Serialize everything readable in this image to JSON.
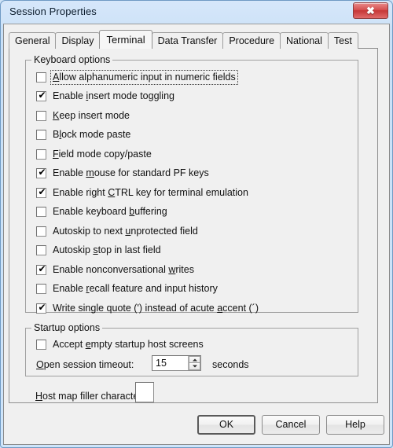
{
  "window": {
    "title": "Session Properties",
    "close_glyph": "✖",
    "close_label": "Close"
  },
  "tabs": [
    {
      "label": "General",
      "selected": false
    },
    {
      "label": "Display",
      "selected": false
    },
    {
      "label": "Terminal",
      "selected": true
    },
    {
      "label": "Data Transfer",
      "selected": false
    },
    {
      "label": "Procedure",
      "selected": false
    },
    {
      "label": "National",
      "selected": false
    },
    {
      "label": "Test",
      "selected": false
    }
  ],
  "keyboard_options": {
    "group_label": "Keyboard options",
    "items": [
      {
        "label": "Allow alphanumeric input in numeric fields",
        "checked": false,
        "focused": true,
        "accel": "A"
      },
      {
        "label": "Enable insert mode toggling",
        "checked": true,
        "focused": false,
        "accel": "i"
      },
      {
        "label": "Keep insert mode",
        "checked": false,
        "focused": false,
        "accel": "K"
      },
      {
        "label": "Block mode paste",
        "checked": false,
        "focused": false,
        "accel": "l"
      },
      {
        "label": "Field mode copy/paste",
        "checked": false,
        "focused": false,
        "accel": "F"
      },
      {
        "label": "Enable mouse for standard PF keys",
        "checked": true,
        "focused": false,
        "accel": "m"
      },
      {
        "label": "Enable right CTRL key for terminal emulation",
        "checked": true,
        "focused": false,
        "accel": "C"
      },
      {
        "label": "Enable keyboard buffering",
        "checked": false,
        "focused": false,
        "accel": "b"
      },
      {
        "label": "Autoskip to next unprotected field",
        "checked": false,
        "focused": false,
        "accel": "u"
      },
      {
        "label": "Autoskip stop in last field",
        "checked": false,
        "focused": false,
        "accel": "s"
      },
      {
        "label": "Enable nonconversational writes",
        "checked": true,
        "focused": false,
        "accel": "w"
      },
      {
        "label": "Enable recall feature and input history",
        "checked": false,
        "focused": false,
        "accel": "r"
      },
      {
        "label": "Write single quote (') instead of acute accent (´)",
        "checked": true,
        "focused": false,
        "accel": "a"
      }
    ]
  },
  "startup_options": {
    "group_label": "Startup options",
    "accept_empty": {
      "label": "Accept empty startup host screens",
      "checked": false,
      "accel": "e"
    },
    "timeout": {
      "label": "Open session timeout:",
      "accel": "O",
      "value": "15",
      "units": "seconds"
    }
  },
  "host_map": {
    "label": "Host map filler character:",
    "accel": "H",
    "value": ""
  },
  "buttons": {
    "ok": "OK",
    "cancel": "Cancel",
    "help": "Help"
  },
  "checkmark": "✔"
}
